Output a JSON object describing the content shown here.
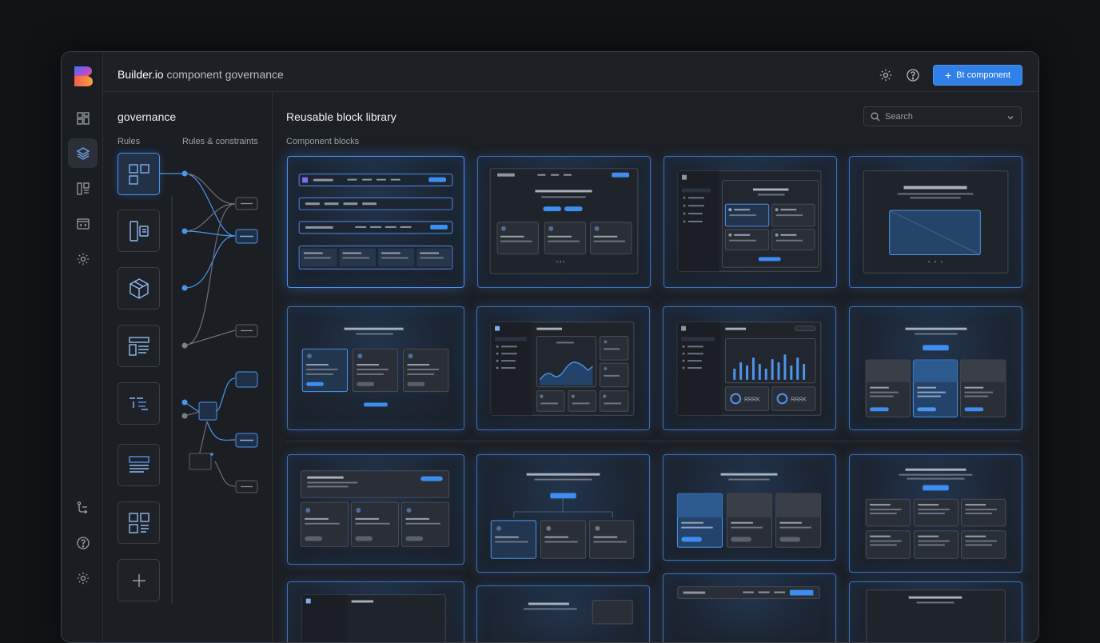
{
  "app": {
    "brand": "Builder.io",
    "title_rest": " component governance",
    "primary_button": "Bt component",
    "icons": {
      "logo": "builder-logo",
      "gear": "gear-icon",
      "help": "help-icon",
      "plus": "plus-icon"
    },
    "accent": "#2f80e8"
  },
  "rail": {
    "items": [
      {
        "icon": "dashboard-icon",
        "active": false
      },
      {
        "icon": "layers-icon",
        "active": true
      },
      {
        "icon": "components-icon",
        "active": false
      },
      {
        "icon": "code-window-icon",
        "active": false
      },
      {
        "icon": "gear-icon",
        "active": false
      }
    ],
    "bottom": [
      {
        "icon": "workflow-icon"
      },
      {
        "icon": "help-icon"
      },
      {
        "icon": "gear-icon"
      }
    ]
  },
  "panel": {
    "title": "governance",
    "col_rules": "Rules",
    "col_constraints": "Rules & constraints",
    "rules": [
      {
        "icon": "grid-icon",
        "active": true
      },
      {
        "icon": "layout-split-icon",
        "active": false
      },
      {
        "icon": "cube-icon",
        "active": false
      },
      {
        "icon": "text-block-icon",
        "active": false
      },
      {
        "icon": "list-structure-icon",
        "active": false
      },
      {
        "icon": "document-icon",
        "active": false
      },
      {
        "icon": "grid-list-icon",
        "active": false
      },
      {
        "icon": "plus-icon",
        "active": false
      }
    ]
  },
  "main": {
    "title": "Reusable block library",
    "section": "Component blocks",
    "search_placeholder": "Search",
    "cards": [
      {
        "kind": "nav-rows"
      },
      {
        "kind": "landing-cards"
      },
      {
        "kind": "sidebar-grid"
      },
      {
        "kind": "hero-image"
      },
      {
        "kind": "feature-cards"
      },
      {
        "kind": "dashboard-line"
      },
      {
        "kind": "dashboard-bars"
      },
      {
        "kind": "pricing"
      },
      {
        "kind": "list-cards"
      },
      {
        "kind": "tree-cards"
      },
      {
        "kind": "image-cards"
      },
      {
        "kind": "grid-six"
      }
    ],
    "stat_labels": [
      "RRRK",
      "RRRK"
    ]
  }
}
